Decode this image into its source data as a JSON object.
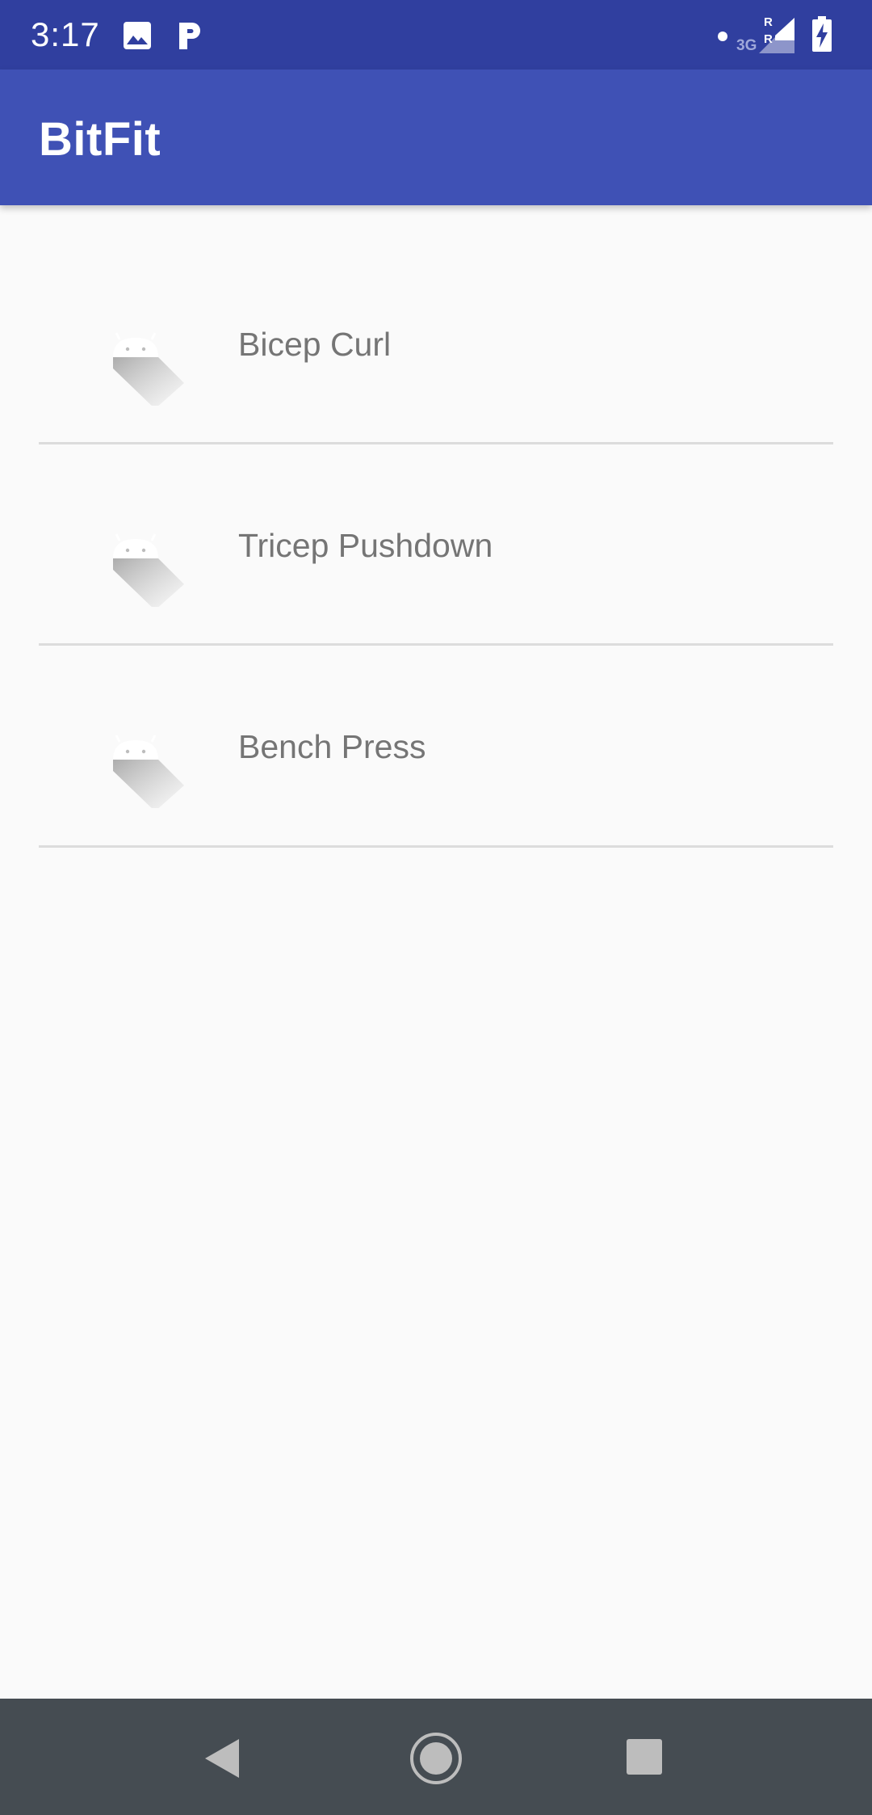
{
  "status_bar": {
    "time": "3:17",
    "icons": [
      "image-icon",
      "parking-icon",
      "dot-icon",
      "signal-3g-icon",
      "battery-charging-icon"
    ],
    "network_label": "3G",
    "roaming_label": "R"
  },
  "app_bar": {
    "title": "BitFit"
  },
  "exercises": [
    {
      "label": "Bicep Curl",
      "icon": "android-placeholder-icon"
    },
    {
      "label": "Tricep Pushdown",
      "icon": "android-placeholder-icon"
    },
    {
      "label": "Bench Press",
      "icon": "android-placeholder-icon"
    }
  ],
  "nav_bar": {
    "buttons": [
      "back-icon",
      "home-icon",
      "recents-icon"
    ]
  },
  "colors": {
    "status_bar": "#303f9f",
    "app_bar": "#3f51b5",
    "background": "#fafafa",
    "item_text": "#757575",
    "divider": "#dcdcdc",
    "nav_bar": "#454c52"
  }
}
